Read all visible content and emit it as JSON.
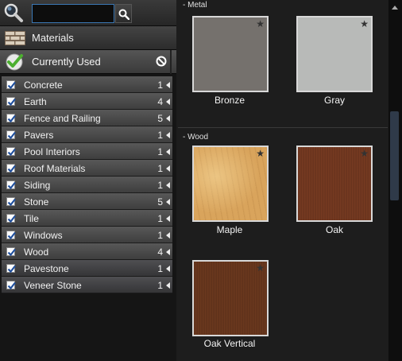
{
  "search": {
    "value": "",
    "placeholder": ""
  },
  "nav": {
    "materials_label": "Materials",
    "currently_used_label": "Currently Used"
  },
  "categories": [
    {
      "name": "Concrete",
      "count": "1",
      "checked": true
    },
    {
      "name": "Earth",
      "count": "4",
      "checked": true
    },
    {
      "name": "Fence and Railing",
      "count": "5",
      "checked": true
    },
    {
      "name": "Pavers",
      "count": "1",
      "checked": true
    },
    {
      "name": "Pool Interiors",
      "count": "1",
      "checked": true
    },
    {
      "name": "Roof Materials",
      "count": "1",
      "checked": true
    },
    {
      "name": "Siding",
      "count": "1",
      "checked": true
    },
    {
      "name": "Stone",
      "count": "5",
      "checked": true
    },
    {
      "name": "Tile",
      "count": "1",
      "checked": true
    },
    {
      "name": "Windows",
      "count": "1",
      "checked": true
    },
    {
      "name": "Wood",
      "count": "4",
      "checked": true
    },
    {
      "name": "Pavestone",
      "count": "1",
      "checked": true
    },
    {
      "name": "Veneer Stone",
      "count": "1",
      "checked": true
    }
  ],
  "sections": {
    "metal": {
      "header": "- Metal",
      "items": [
        {
          "name": "Bronze",
          "color": "#75716d"
        },
        {
          "name": "Gray",
          "color": "#b8bab8"
        }
      ]
    },
    "wood": {
      "header": "- Wood",
      "items": [
        {
          "name": "Maple",
          "color": "#d9a45c"
        },
        {
          "name": "Oak",
          "color": "#7a3c22"
        },
        {
          "name": "Oak Vertical",
          "color": "#6e3a1f"
        }
      ]
    }
  },
  "colors": {
    "accent_blue": "#3b78b5",
    "checkmark_green": "#4caf30",
    "scroll_thumb": "#2f3a49"
  }
}
